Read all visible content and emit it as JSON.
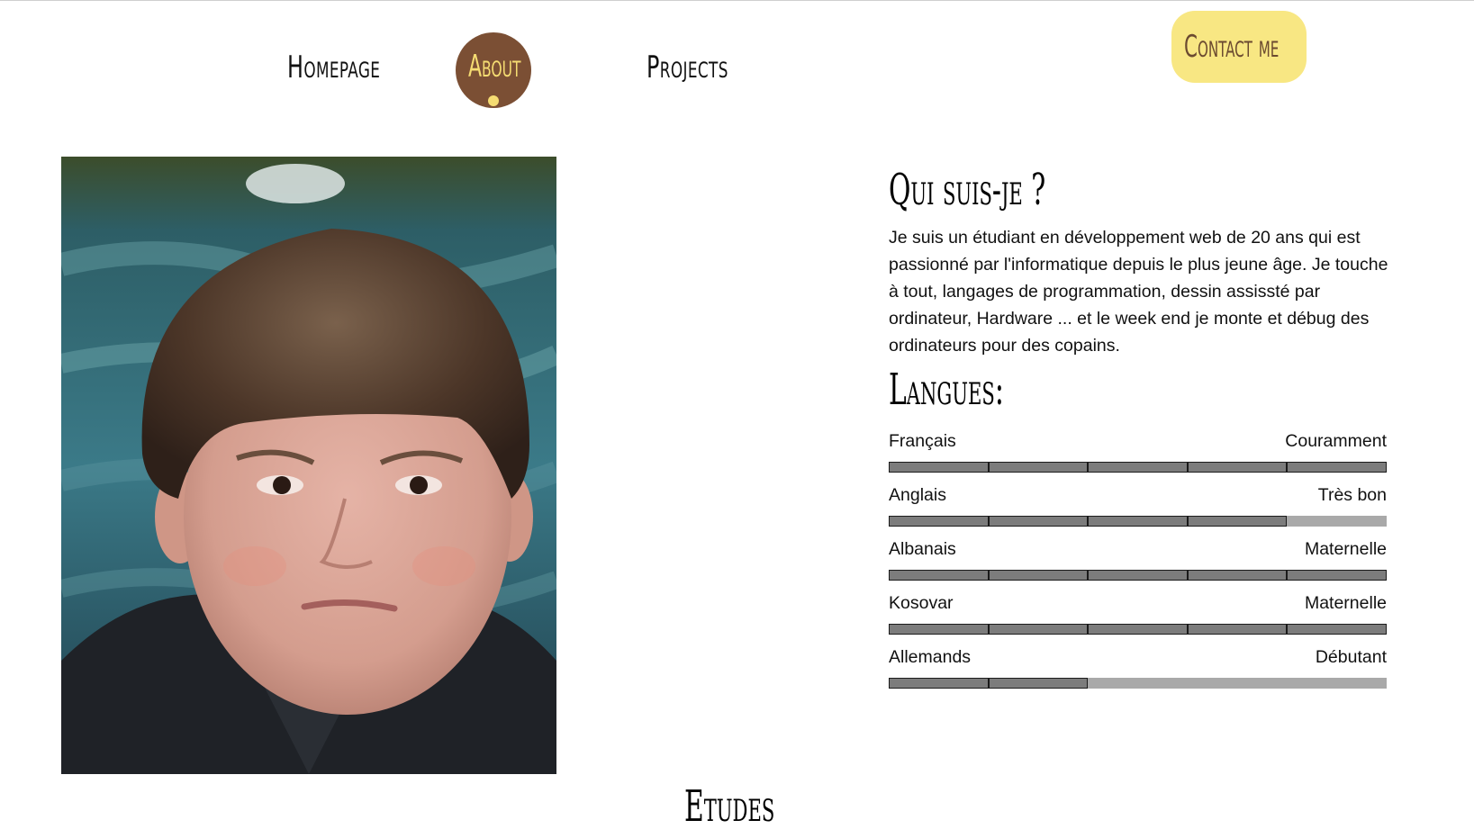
{
  "nav": {
    "home_label": "Homepage",
    "about_label": "About",
    "projects_label": "Projects",
    "contact_label": "Contact me"
  },
  "colors": {
    "accent_brown": "#7b4f34",
    "accent_yellow": "#f5dc72",
    "contact_bg": "#f8e783",
    "bar_fill": "#7c7c7c",
    "bar_empty": "#a9a9a9"
  },
  "about": {
    "title": "Qui suis-je ?",
    "bio": "Je suis un étudiant en développement web de 20 ans qui est passionné par l'informatique depuis le plus jeune âge. Je touche à tout, langages de programmation, dessin assissté par ordinateur, Hardware ... et le week end je monte et débug des ordinateurs pour des copains."
  },
  "languages": {
    "title": "Langues:",
    "segments_total": 5,
    "items": [
      {
        "name": "Français",
        "level": "Couramment",
        "filled": 5
      },
      {
        "name": "Anglais",
        "level": "Très bon",
        "filled": 4
      },
      {
        "name": "Albanais",
        "level": "Maternelle",
        "filled": 5
      },
      {
        "name": "Kosovar",
        "level": "Maternelle",
        "filled": 5
      },
      {
        "name": "Allemands",
        "level": "Débutant",
        "filled": 2
      }
    ]
  },
  "studies": {
    "title": "Etudes"
  },
  "icons": {
    "photo": "portrait-photo"
  }
}
